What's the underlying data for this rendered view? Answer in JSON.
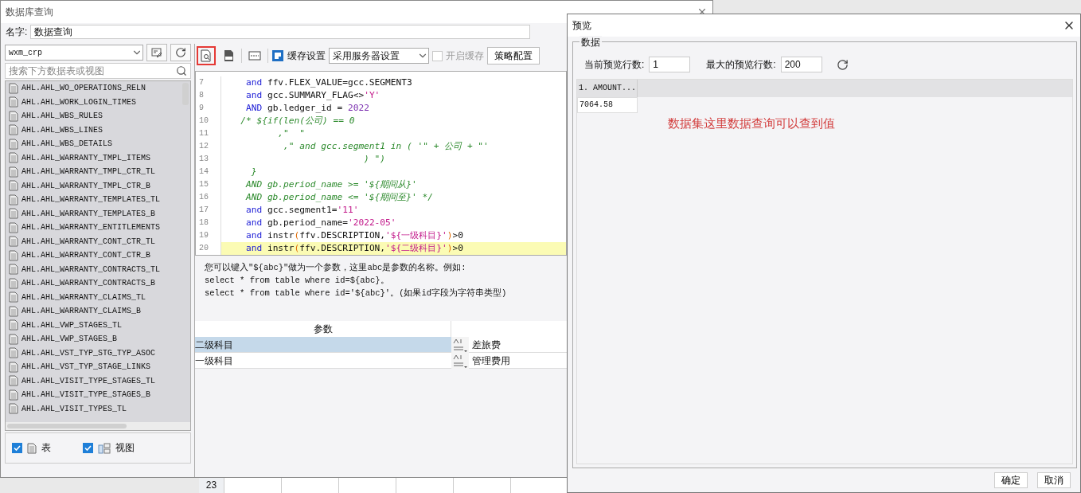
{
  "main_window": {
    "title": "数据库查询",
    "name_label": "名字:",
    "name_value": "数据查询"
  },
  "connection": {
    "value": "wxm_crp"
  },
  "table_search": {
    "placeholder": "搜索下方数据表或视图"
  },
  "tables": [
    "AHL.AHL_WO_OPERATIONS_RELN",
    "AHL.AHL_WORK_LOGIN_TIMES",
    "AHL.AHL_WBS_RULES",
    "AHL.AHL_WBS_LINES",
    "AHL.AHL_WBS_DETAILS",
    "AHL.AHL_WARRANTY_TMPL_ITEMS",
    "AHL.AHL_WARRANTY_TMPL_CTR_TL",
    "AHL.AHL_WARRANTY_TMPL_CTR_B",
    "AHL.AHL_WARRANTY_TEMPLATES_TL",
    "AHL.AHL_WARRANTY_TEMPLATES_B",
    "AHL.AHL_WARRANTY_ENTITLEMENTS",
    "AHL.AHL_WARRANTY_CONT_CTR_TL",
    "AHL.AHL_WARRANTY_CONT_CTR_B",
    "AHL.AHL_WARRANTY_CONTRACTS_TL",
    "AHL.AHL_WARRANTY_CONTRACTS_B",
    "AHL.AHL_WARRANTY_CLAIMS_TL",
    "AHL.AHL_WARRANTY_CLAIMS_B",
    "AHL.AHL_VWP_STAGES_TL",
    "AHL.AHL_VWP_STAGES_B",
    "AHL.AHL_VST_TYP_STG_TYP_ASOC",
    "AHL.AHL_VST_TYP_STAGE_LINKS",
    "AHL.AHL_VISIT_TYPE_STAGES_TL",
    "AHL.AHL_VISIT_TYPE_STAGES_B",
    "AHL.AHL_VISIT_TYPES_TL"
  ],
  "filters": [
    {
      "label": "表",
      "checked": true,
      "kind": "table"
    },
    {
      "label": "视图",
      "checked": true,
      "kind": "view"
    }
  ],
  "toolbar": {
    "cache_label": "缓存设置",
    "cache_mode": "采用服务器设置",
    "cache_enabled_label": "开启缓存",
    "cache_enabled": false,
    "cache_enabled_disabled": true,
    "policy_button": "策略配置",
    "preview_highlighted": true
  },
  "code_lines": [
    {
      "num": "7",
      "highlighted": false,
      "tokens": [
        {
          "kind": "kw",
          "text": "    and"
        },
        {
          "kind": "plain",
          "text": " ffv.FLEX_VALUE=gcc.SEGMENT3"
        }
      ]
    },
    {
      "num": "8",
      "highlighted": false,
      "tokens": [
        {
          "kind": "kw",
          "text": "    and"
        },
        {
          "kind": "plain",
          "text": " gcc.SUMMARY_FLAG<>"
        },
        {
          "kind": "str",
          "text": "'Y'"
        }
      ]
    },
    {
      "num": "9",
      "highlighted": false,
      "tokens": [
        {
          "kind": "kw",
          "text": "    AND"
        },
        {
          "kind": "plain",
          "text": " gb.ledger_id = "
        },
        {
          "kind": "num",
          "text": "2022"
        }
      ]
    },
    {
      "num": "10",
      "highlighted": false,
      "tokens": [
        {
          "kind": "comment",
          "text": "   /* ${if(len(公司) == 0"
        }
      ]
    },
    {
      "num": "11",
      "highlighted": false,
      "tokens": [
        {
          "kind": "comment",
          "text": "          ,\"  \""
        }
      ]
    },
    {
      "num": "12",
      "highlighted": false,
      "tokens": [
        {
          "kind": "comment",
          "text": "           ,\" and gcc.segment1 in ( '\" + 公司 + \"'"
        }
      ]
    },
    {
      "num": "13",
      "highlighted": false,
      "tokens": [
        {
          "kind": "comment",
          "text": "                          ) \")"
        }
      ]
    },
    {
      "num": "14",
      "highlighted": false,
      "tokens": [
        {
          "kind": "comment",
          "text": "     }"
        }
      ]
    },
    {
      "num": "15",
      "highlighted": false,
      "tokens": [
        {
          "kind": "comment",
          "text": "    AND gb.period_name >= '${期间从}'"
        }
      ]
    },
    {
      "num": "16",
      "highlighted": false,
      "tokens": [
        {
          "kind": "comment",
          "text": "    AND gb.period_name <= '${期间至}' */"
        }
      ]
    },
    {
      "num": "17",
      "highlighted": false,
      "tokens": [
        {
          "kind": "kw",
          "text": "    and"
        },
        {
          "kind": "plain",
          "text": " gcc.segment1="
        },
        {
          "kind": "str",
          "text": "'11'"
        }
      ]
    },
    {
      "num": "18",
      "highlighted": false,
      "tokens": [
        {
          "kind": "kw",
          "text": "    and"
        },
        {
          "kind": "plain",
          "text": " gb.period_name="
        },
        {
          "kind": "str",
          "text": "'2022-05'"
        }
      ]
    },
    {
      "num": "19",
      "highlighted": false,
      "tokens": [
        {
          "kind": "kw",
          "text": "    and"
        },
        {
          "kind": "plain",
          "text": " instr"
        },
        {
          "kind": "paren",
          "text": "("
        },
        {
          "kind": "plain",
          "text": "ffv.DESCRIPTION,"
        },
        {
          "kind": "str",
          "text": "'${一级科目}'"
        },
        {
          "kind": "paren",
          "text": ")"
        },
        {
          "kind": "plain",
          "text": ">0"
        }
      ]
    },
    {
      "num": "20",
      "highlighted": true,
      "tokens": [
        {
          "kind": "kw",
          "text": "    and"
        },
        {
          "kind": "plain",
          "text": " instr"
        },
        {
          "kind": "paren",
          "text": "("
        },
        {
          "kind": "plain",
          "text": "ffv.DESCRIPTION,"
        },
        {
          "kind": "str",
          "text": "'${二级科目}'"
        },
        {
          "kind": "paren",
          "text": ")"
        },
        {
          "kind": "plain",
          "text": ">0"
        }
      ]
    }
  ],
  "help_lines": [
    "您可以键入\"${abc}\"做为一个参数，这里abc是参数的名称。例如:",
    "select * from table where id=${abc}。",
    "select * from table where id='${abc}'。(如果id字段为字符串类型)"
  ],
  "params": {
    "columns": [
      "参数"
    ],
    "rows": [
      {
        "name": "二级科目",
        "value": "差旅费",
        "selected": true
      },
      {
        "name": "一级科目",
        "value": "管理费用",
        "selected": false
      }
    ]
  },
  "sheet_row": "23",
  "preview": {
    "title": "预览",
    "group": "数据",
    "current_label": "当前预览行数:",
    "current_value": "1",
    "max_label": "最大的预览行数:",
    "max_value": "200",
    "columns": [
      "1. AMOUNT..."
    ],
    "rows": [
      [
        "7064.58"
      ]
    ],
    "note": "数据集这里数据查询可以查到值",
    "buttons": [
      "确定",
      "取消"
    ]
  }
}
